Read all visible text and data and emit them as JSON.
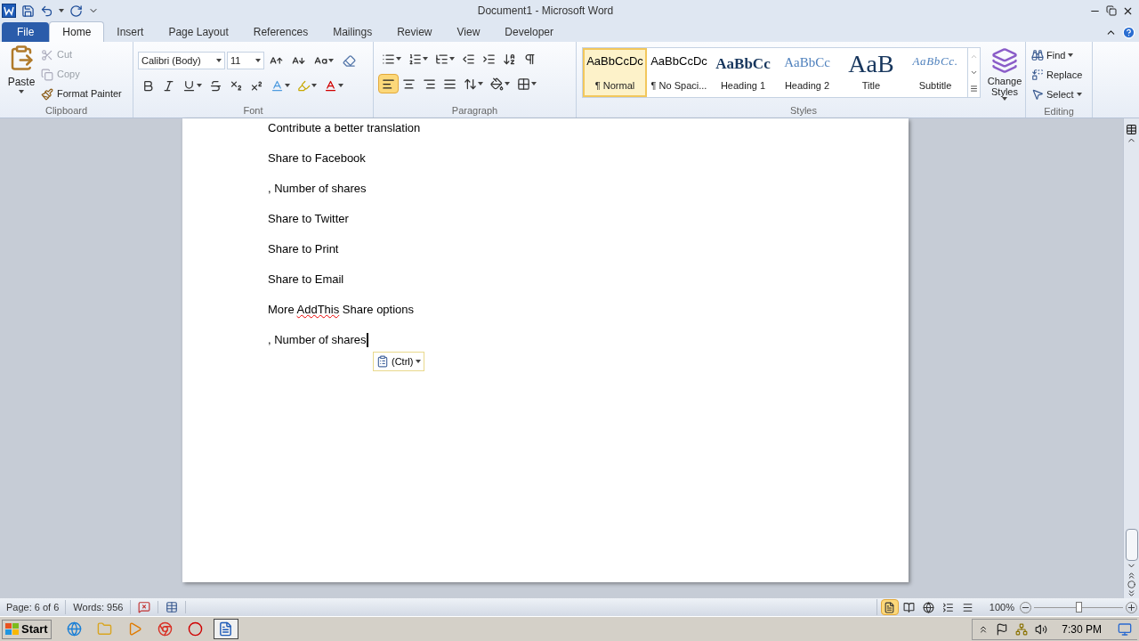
{
  "window": {
    "title": "Document1 - Microsoft Word"
  },
  "tabs": [
    {
      "label": "File",
      "kind": "backstage",
      "selected": false
    },
    {
      "label": "Home",
      "kind": "tab",
      "selected": true
    },
    {
      "label": "Insert",
      "kind": "tab",
      "selected": false
    },
    {
      "label": "Page Layout",
      "kind": "tab",
      "selected": false
    },
    {
      "label": "References",
      "kind": "tab",
      "selected": false
    },
    {
      "label": "Mailings",
      "kind": "tab",
      "selected": false
    },
    {
      "label": "Review",
      "kind": "tab",
      "selected": false
    },
    {
      "label": "View",
      "kind": "tab",
      "selected": false
    },
    {
      "label": "Developer",
      "kind": "tab",
      "selected": false
    }
  ],
  "clipboard": {
    "group": "Clipboard",
    "paste": "Paste",
    "items": [
      {
        "kind": "cut",
        "label": "Cut",
        "disabled": true
      },
      {
        "kind": "copy",
        "label": "Copy",
        "disabled": true
      },
      {
        "kind": "painter",
        "label": "Format Painter",
        "disabled": false
      }
    ]
  },
  "font": {
    "group": "Font",
    "family": "Calibri (Body)",
    "size": "11"
  },
  "paragraph": {
    "group": "Paragraph",
    "alignments": [
      {
        "kind": "left",
        "selected": true
      },
      {
        "kind": "center",
        "selected": false
      },
      {
        "kind": "right",
        "selected": false
      },
      {
        "kind": "justify",
        "selected": false
      }
    ]
  },
  "styles": {
    "group": "Styles",
    "change": "Change Styles",
    "items": [
      {
        "preview": "AaBbCcDc",
        "name": "¶ Normal",
        "kind": "body",
        "selected": true
      },
      {
        "preview": "AaBbCcDc",
        "name": "¶ No Spaci...",
        "kind": "body",
        "selected": false
      },
      {
        "preview": "AaBbCc",
        "name": "Heading 1",
        "kind": "heading1",
        "selected": false
      },
      {
        "preview": "AaBbCc",
        "name": "Heading 2",
        "kind": "heading2",
        "selected": false
      },
      {
        "preview": "AaB",
        "name": "Title",
        "kind": "title",
        "selected": false
      },
      {
        "preview": "AaBbCc.",
        "name": "Subtitle",
        "kind": "subtitle",
        "selected": false
      }
    ]
  },
  "editing": {
    "group": "Editing",
    "items": [
      {
        "kind": "find",
        "label": "Find"
      },
      {
        "kind": "replace",
        "label": "Replace"
      },
      {
        "kind": "select",
        "label": "Select"
      }
    ]
  },
  "document": {
    "paragraphs": [
      {
        "segments": [
          {
            "text": "Contribute a better translation",
            "misspelled": false
          }
        ],
        "caret": false
      },
      {
        "segments": [
          {
            "text": "Share to Facebook",
            "misspelled": false
          }
        ],
        "caret": false
      },
      {
        "segments": [
          {
            "text": ", Number of shares",
            "misspelled": false
          }
        ],
        "caret": false
      },
      {
        "segments": [
          {
            "text": "Share to Twitter",
            "misspelled": false
          }
        ],
        "caret": false
      },
      {
        "segments": [
          {
            "text": "Share to Print",
            "misspelled": false
          }
        ],
        "caret": false
      },
      {
        "segments": [
          {
            "text": "Share to Email",
            "misspelled": false
          }
        ],
        "caret": false
      },
      {
        "segments": [
          {
            "text": "More ",
            "misspelled": false
          },
          {
            "text": "AddThis",
            "misspelled": true
          },
          {
            "text": " Share options",
            "misspelled": false
          }
        ],
        "caret": false
      },
      {
        "segments": [
          {
            "text": ", Number of shares",
            "misspelled": false
          }
        ],
        "caret": true
      }
    ],
    "paste_options": "(Ctrl)"
  },
  "status_bar": {
    "page": "Page: 6 of 6",
    "words": "Words: 956",
    "views": [
      {
        "kind": "print",
        "selected": true
      },
      {
        "kind": "reading",
        "selected": false
      },
      {
        "kind": "web",
        "selected": false
      },
      {
        "kind": "outline",
        "selected": false
      },
      {
        "kind": "draft",
        "selected": false
      }
    ],
    "zoom": "100%",
    "zoom_slider": {
      "level": 0.5
    }
  },
  "taskbar": {
    "start": "Start",
    "apps": [
      {
        "kind": "ie",
        "selected": false
      },
      {
        "kind": "explorer",
        "selected": false
      },
      {
        "kind": "media",
        "selected": false
      },
      {
        "kind": "chrome",
        "selected": false
      },
      {
        "kind": "opera",
        "selected": false
      },
      {
        "kind": "word",
        "selected": true
      }
    ],
    "clock": "7:30 PM"
  }
}
